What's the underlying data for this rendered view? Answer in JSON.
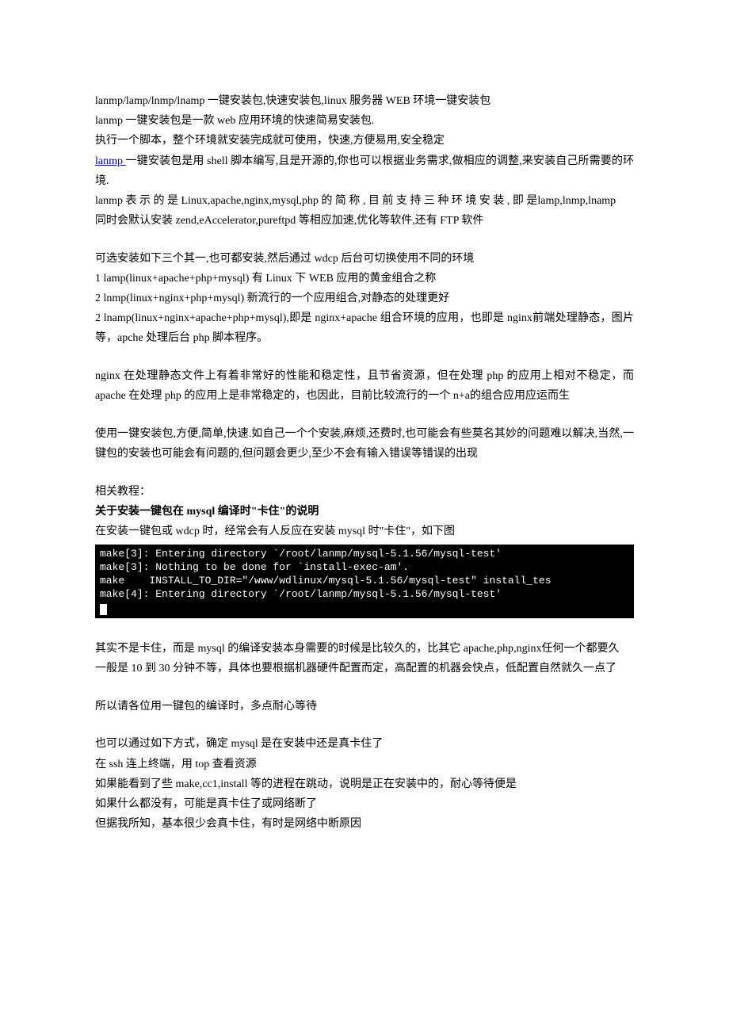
{
  "p1": "lanmp/lamp/lnmp/lnamp 一键安装包,快速安装包,linux 服务器 WEB 环境一键安装包",
  "p2": "lanmp 一键安装包是一款 web 应用环境的快速简易安装包.",
  "p3": "执行一个脚本，整个环境就安装完成就可使用，快速,方便易用,安全稳定",
  "p4_link": "lanmp ",
  "p4_rest": "一键安装包是用 shell 脚本编写,且是开源的,你也可以根据业务需求,做相应的调整,来安装自己所需要的环境.",
  "p5": "lanmp 表 示 的 是 Linux,apache,nginx,mysql,php 的 简 称 , 目 前 支 持 三 种 环 境 安 装 , 即 是lamp,lnmp,lnamp",
  "p6": "同时会默认安装 zend,eAccelerator,pureftpd 等相应加速,优化等软件,还有 FTP 软件",
  "p7": "可选安装如下三个其一,也可都安装,然后通过 wdcp 后台可切换使用不同的环境",
  "p8": "1 lamp(linux+apache+php+mysql)  有 Linux 下 WEB 应用的黄金组合之称",
  "p9": "2 lnmp(linux+nginx+php+mysql)  新流行的一个应用组合,对静态的处理更好",
  "p10": "2 lnamp(linux+nginx+apache+php+mysql),即是 nginx+apache 组合环境的应用，也即是 nginx前端处理静态，图片等，apche 处理后台 php 脚本程序。",
  "p11": "nginx 在处理静态文件上有着非常好的性能和稳定性，且节省资源，但在处理 php 的应用上相对不稳定，而 apache 在处理 php 的应用上是非常稳定的，也因此，目前比较流行的一个 n+a的组合应用应运而生",
  "p12": "使用一键安装包,方便,简单,快速.如自己一个个安装,麻烦,还费时,也可能会有些莫名其妙的问题难以解决,当然,一键包的安装也可能会有问题的,但问题会更少,至少不会有输入错误等错误的出现",
  "p13": "相关教程：",
  "p14": "关于安装一键包在 mysql 编译时\"卡住\"的说明",
  "p15": "在安装一键包或 wdcp 时，经常会有人反应在安装 mysql 时\"卡住\"，如下图",
  "terminal": {
    "l1": "make[3]: Entering directory `/root/lanmp/mysql-5.1.56/mysql-test'",
    "l2": "make[3]: Nothing to be done for `install-exec-am'.",
    "l3": "make    INSTALL_TO_DIR=\"/www/wdlinux/mysql-5.1.56/mysql-test\" install_tes",
    "l4": "make[4]: Entering directory `/root/lanmp/mysql-5.1.56/mysql-test'"
  },
  "p16": "其实不是卡住，而是 mysql 的编译安装本身需要的时候是比较久的，比其它 apache,php,nginx任何一个都要久",
  "p17": "一般是 10 到 30 分钟不等，具体也要根据机器硬件配置而定，高配置的机器会快点，低配置自然就久一点了",
  "p18": "所以请各位用一键包的编译时，多点耐心等待",
  "p19": "也可以通过如下方式，确定 mysql 是在安装中还是真卡住了",
  "p20": "在 ssh 连上终端，用 top 查看资源",
  "p21": "如果能看到了些 make,cc1,install 等的进程在跳动，说明是正在安装中的，耐心等待便是",
  "p22": "如果什么都没有，可能是真卡住了或网络断了",
  "p23": "但据我所知，基本很少会真卡住，有时是网络中断原因"
}
